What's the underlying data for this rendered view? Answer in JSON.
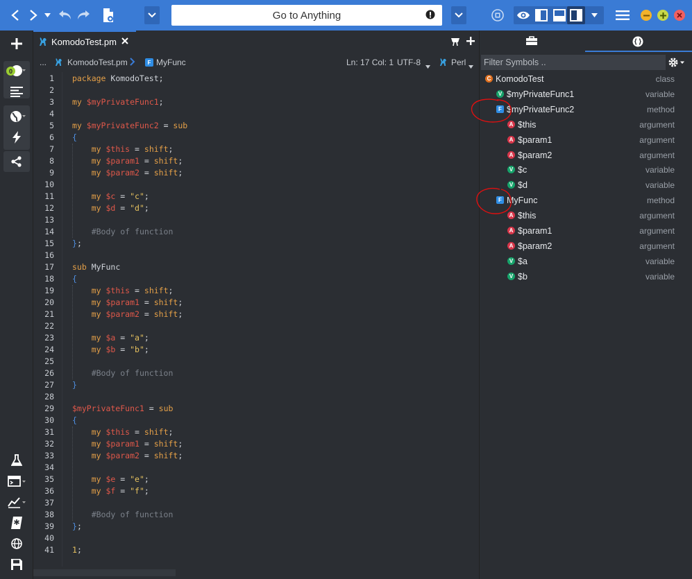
{
  "toolbar": {
    "goto_label": "Go to Anything",
    "icons": [
      "back-icon",
      "forward-icon",
      "undo-icon",
      "redo-icon",
      "new-file-icon",
      "dropdown-icon",
      "mode-icon",
      "eye-icon",
      "left-pane-icon",
      "bottom-pane-icon",
      "right-pane-icon",
      "menu-icon"
    ]
  },
  "sidebar": {
    "badge": "0"
  },
  "tab": {
    "label": "KomodoTest.pm"
  },
  "breadcrumb": {
    "ellipsis": "...",
    "file": "KomodoTest.pm",
    "func_badge": "F",
    "func": "MyFunc",
    "position": "Ln: 17 Col: 1",
    "encoding": "UTF-8",
    "language": "Perl"
  },
  "filter": {
    "placeholder": "Filter Symbols .."
  },
  "code": {
    "lines": [
      [
        [
          "kw",
          "package"
        ],
        [
          "pl",
          " KomodoTest;"
        ]
      ],
      [],
      [
        [
          "kw",
          "my "
        ],
        [
          "vr",
          "$myPrivateFunc1"
        ],
        [
          "pl",
          ";"
        ]
      ],
      [],
      [
        [
          "kw",
          "my "
        ],
        [
          "vr",
          "$myPrivateFunc2"
        ],
        [
          "op",
          " = "
        ],
        [
          "kw",
          "sub"
        ]
      ],
      [
        [
          "br",
          "{"
        ]
      ],
      [
        [
          "pl",
          "    "
        ],
        [
          "kw",
          "my "
        ],
        [
          "vr",
          "$this"
        ],
        [
          "op",
          " = "
        ],
        [
          "kw",
          "shift"
        ],
        [
          "pl",
          ";"
        ]
      ],
      [
        [
          "pl",
          "    "
        ],
        [
          "kw",
          "my "
        ],
        [
          "vr",
          "$param1"
        ],
        [
          "op",
          " = "
        ],
        [
          "kw",
          "shift"
        ],
        [
          "pl",
          ";"
        ]
      ],
      [
        [
          "pl",
          "    "
        ],
        [
          "kw",
          "my "
        ],
        [
          "vr",
          "$param2"
        ],
        [
          "op",
          " = "
        ],
        [
          "kw",
          "shift"
        ],
        [
          "pl",
          ";"
        ]
      ],
      [],
      [
        [
          "pl",
          "    "
        ],
        [
          "kw",
          "my "
        ],
        [
          "vr",
          "$c"
        ],
        [
          "op",
          " = "
        ],
        [
          "st",
          "\"c\""
        ],
        [
          "pl",
          ";"
        ]
      ],
      [
        [
          "pl",
          "    "
        ],
        [
          "kw",
          "my "
        ],
        [
          "vr",
          "$d"
        ],
        [
          "op",
          " = "
        ],
        [
          "st",
          "\"d\""
        ],
        [
          "pl",
          ";"
        ]
      ],
      [],
      [
        [
          "pl",
          "    "
        ],
        [
          "cm",
          "#Body of function"
        ]
      ],
      [
        [
          "br",
          "}"
        ],
        [
          "pl",
          ";"
        ]
      ],
      [],
      [
        [
          "kw",
          "sub"
        ],
        [
          "pl",
          " MyFunc"
        ]
      ],
      [
        [
          "br",
          "{"
        ]
      ],
      [
        [
          "pl",
          "    "
        ],
        [
          "kw",
          "my "
        ],
        [
          "vr",
          "$this"
        ],
        [
          "op",
          " = "
        ],
        [
          "kw",
          "shift"
        ],
        [
          "pl",
          ";"
        ]
      ],
      [
        [
          "pl",
          "    "
        ],
        [
          "kw",
          "my "
        ],
        [
          "vr",
          "$param1"
        ],
        [
          "op",
          " = "
        ],
        [
          "kw",
          "shift"
        ],
        [
          "pl",
          ";"
        ]
      ],
      [
        [
          "pl",
          "    "
        ],
        [
          "kw",
          "my "
        ],
        [
          "vr",
          "$param2"
        ],
        [
          "op",
          " = "
        ],
        [
          "kw",
          "shift"
        ],
        [
          "pl",
          ";"
        ]
      ],
      [],
      [
        [
          "pl",
          "    "
        ],
        [
          "kw",
          "my "
        ],
        [
          "vr",
          "$a"
        ],
        [
          "op",
          " = "
        ],
        [
          "st",
          "\"a\""
        ],
        [
          "pl",
          ";"
        ]
      ],
      [
        [
          "pl",
          "    "
        ],
        [
          "kw",
          "my "
        ],
        [
          "vr",
          "$b"
        ],
        [
          "op",
          " = "
        ],
        [
          "st",
          "\"b\""
        ],
        [
          "pl",
          ";"
        ]
      ],
      [],
      [
        [
          "pl",
          "    "
        ],
        [
          "cm",
          "#Body of function"
        ]
      ],
      [
        [
          "br",
          "}"
        ]
      ],
      [],
      [
        [
          "vr",
          "$myPrivateFunc1"
        ],
        [
          "op",
          " = "
        ],
        [
          "kw",
          "sub"
        ]
      ],
      [
        [
          "br",
          "{"
        ]
      ],
      [
        [
          "pl",
          "    "
        ],
        [
          "kw",
          "my "
        ],
        [
          "vr",
          "$this"
        ],
        [
          "op",
          " = "
        ],
        [
          "kw",
          "shift"
        ],
        [
          "pl",
          ";"
        ]
      ],
      [
        [
          "pl",
          "    "
        ],
        [
          "kw",
          "my "
        ],
        [
          "vr",
          "$param1"
        ],
        [
          "op",
          " = "
        ],
        [
          "kw",
          "shift"
        ],
        [
          "pl",
          ";"
        ]
      ],
      [
        [
          "pl",
          "    "
        ],
        [
          "kw",
          "my "
        ],
        [
          "vr",
          "$param2"
        ],
        [
          "op",
          " = "
        ],
        [
          "kw",
          "shift"
        ],
        [
          "pl",
          ";"
        ]
      ],
      [],
      [
        [
          "pl",
          "    "
        ],
        [
          "kw",
          "my "
        ],
        [
          "vr",
          "$e"
        ],
        [
          "op",
          " = "
        ],
        [
          "st",
          "\"e\""
        ],
        [
          "pl",
          ";"
        ]
      ],
      [
        [
          "pl",
          "    "
        ],
        [
          "kw",
          "my "
        ],
        [
          "vr",
          "$f"
        ],
        [
          "op",
          " = "
        ],
        [
          "st",
          "\"f\""
        ],
        [
          "pl",
          ";"
        ]
      ],
      [],
      [
        [
          "pl",
          "    "
        ],
        [
          "cm",
          "#Body of function"
        ]
      ],
      [
        [
          "br",
          "}"
        ],
        [
          "pl",
          ";"
        ]
      ],
      [],
      [
        [
          "st",
          "1"
        ],
        [
          "pl",
          ";"
        ]
      ]
    ]
  },
  "symbols": [
    {
      "badge": "C",
      "kind": "c",
      "name": "KomodoTest",
      "type": "class",
      "depth": 0
    },
    {
      "badge": "V",
      "kind": "v",
      "name": "$myPrivateFunc1",
      "type": "variable",
      "depth": 1
    },
    {
      "badge": "F",
      "kind": "f",
      "name": "$myPrivateFunc2",
      "type": "method",
      "depth": 1
    },
    {
      "badge": "A",
      "kind": "a",
      "name": "$this",
      "type": "argument",
      "depth": 2
    },
    {
      "badge": "A",
      "kind": "a",
      "name": "$param1",
      "type": "argument",
      "depth": 2
    },
    {
      "badge": "A",
      "kind": "a",
      "name": "$param2",
      "type": "argument",
      "depth": 2
    },
    {
      "badge": "V",
      "kind": "v",
      "name": "$c",
      "type": "variable",
      "depth": 2
    },
    {
      "badge": "V",
      "kind": "v",
      "name": "$d",
      "type": "variable",
      "depth": 2
    },
    {
      "badge": "F",
      "kind": "f",
      "name": "MyFunc",
      "type": "method",
      "depth": 1
    },
    {
      "badge": "A",
      "kind": "a",
      "name": "$this",
      "type": "argument",
      "depth": 2
    },
    {
      "badge": "A",
      "kind": "a",
      "name": "$param1",
      "type": "argument",
      "depth": 2
    },
    {
      "badge": "A",
      "kind": "a",
      "name": "$param2",
      "type": "argument",
      "depth": 2
    },
    {
      "badge": "V",
      "kind": "v",
      "name": "$a",
      "type": "variable",
      "depth": 2
    },
    {
      "badge": "V",
      "kind": "v",
      "name": "$b",
      "type": "variable",
      "depth": 2
    }
  ],
  "colors": {
    "accent": "#3a7bd5",
    "annotation": "#e01010"
  }
}
